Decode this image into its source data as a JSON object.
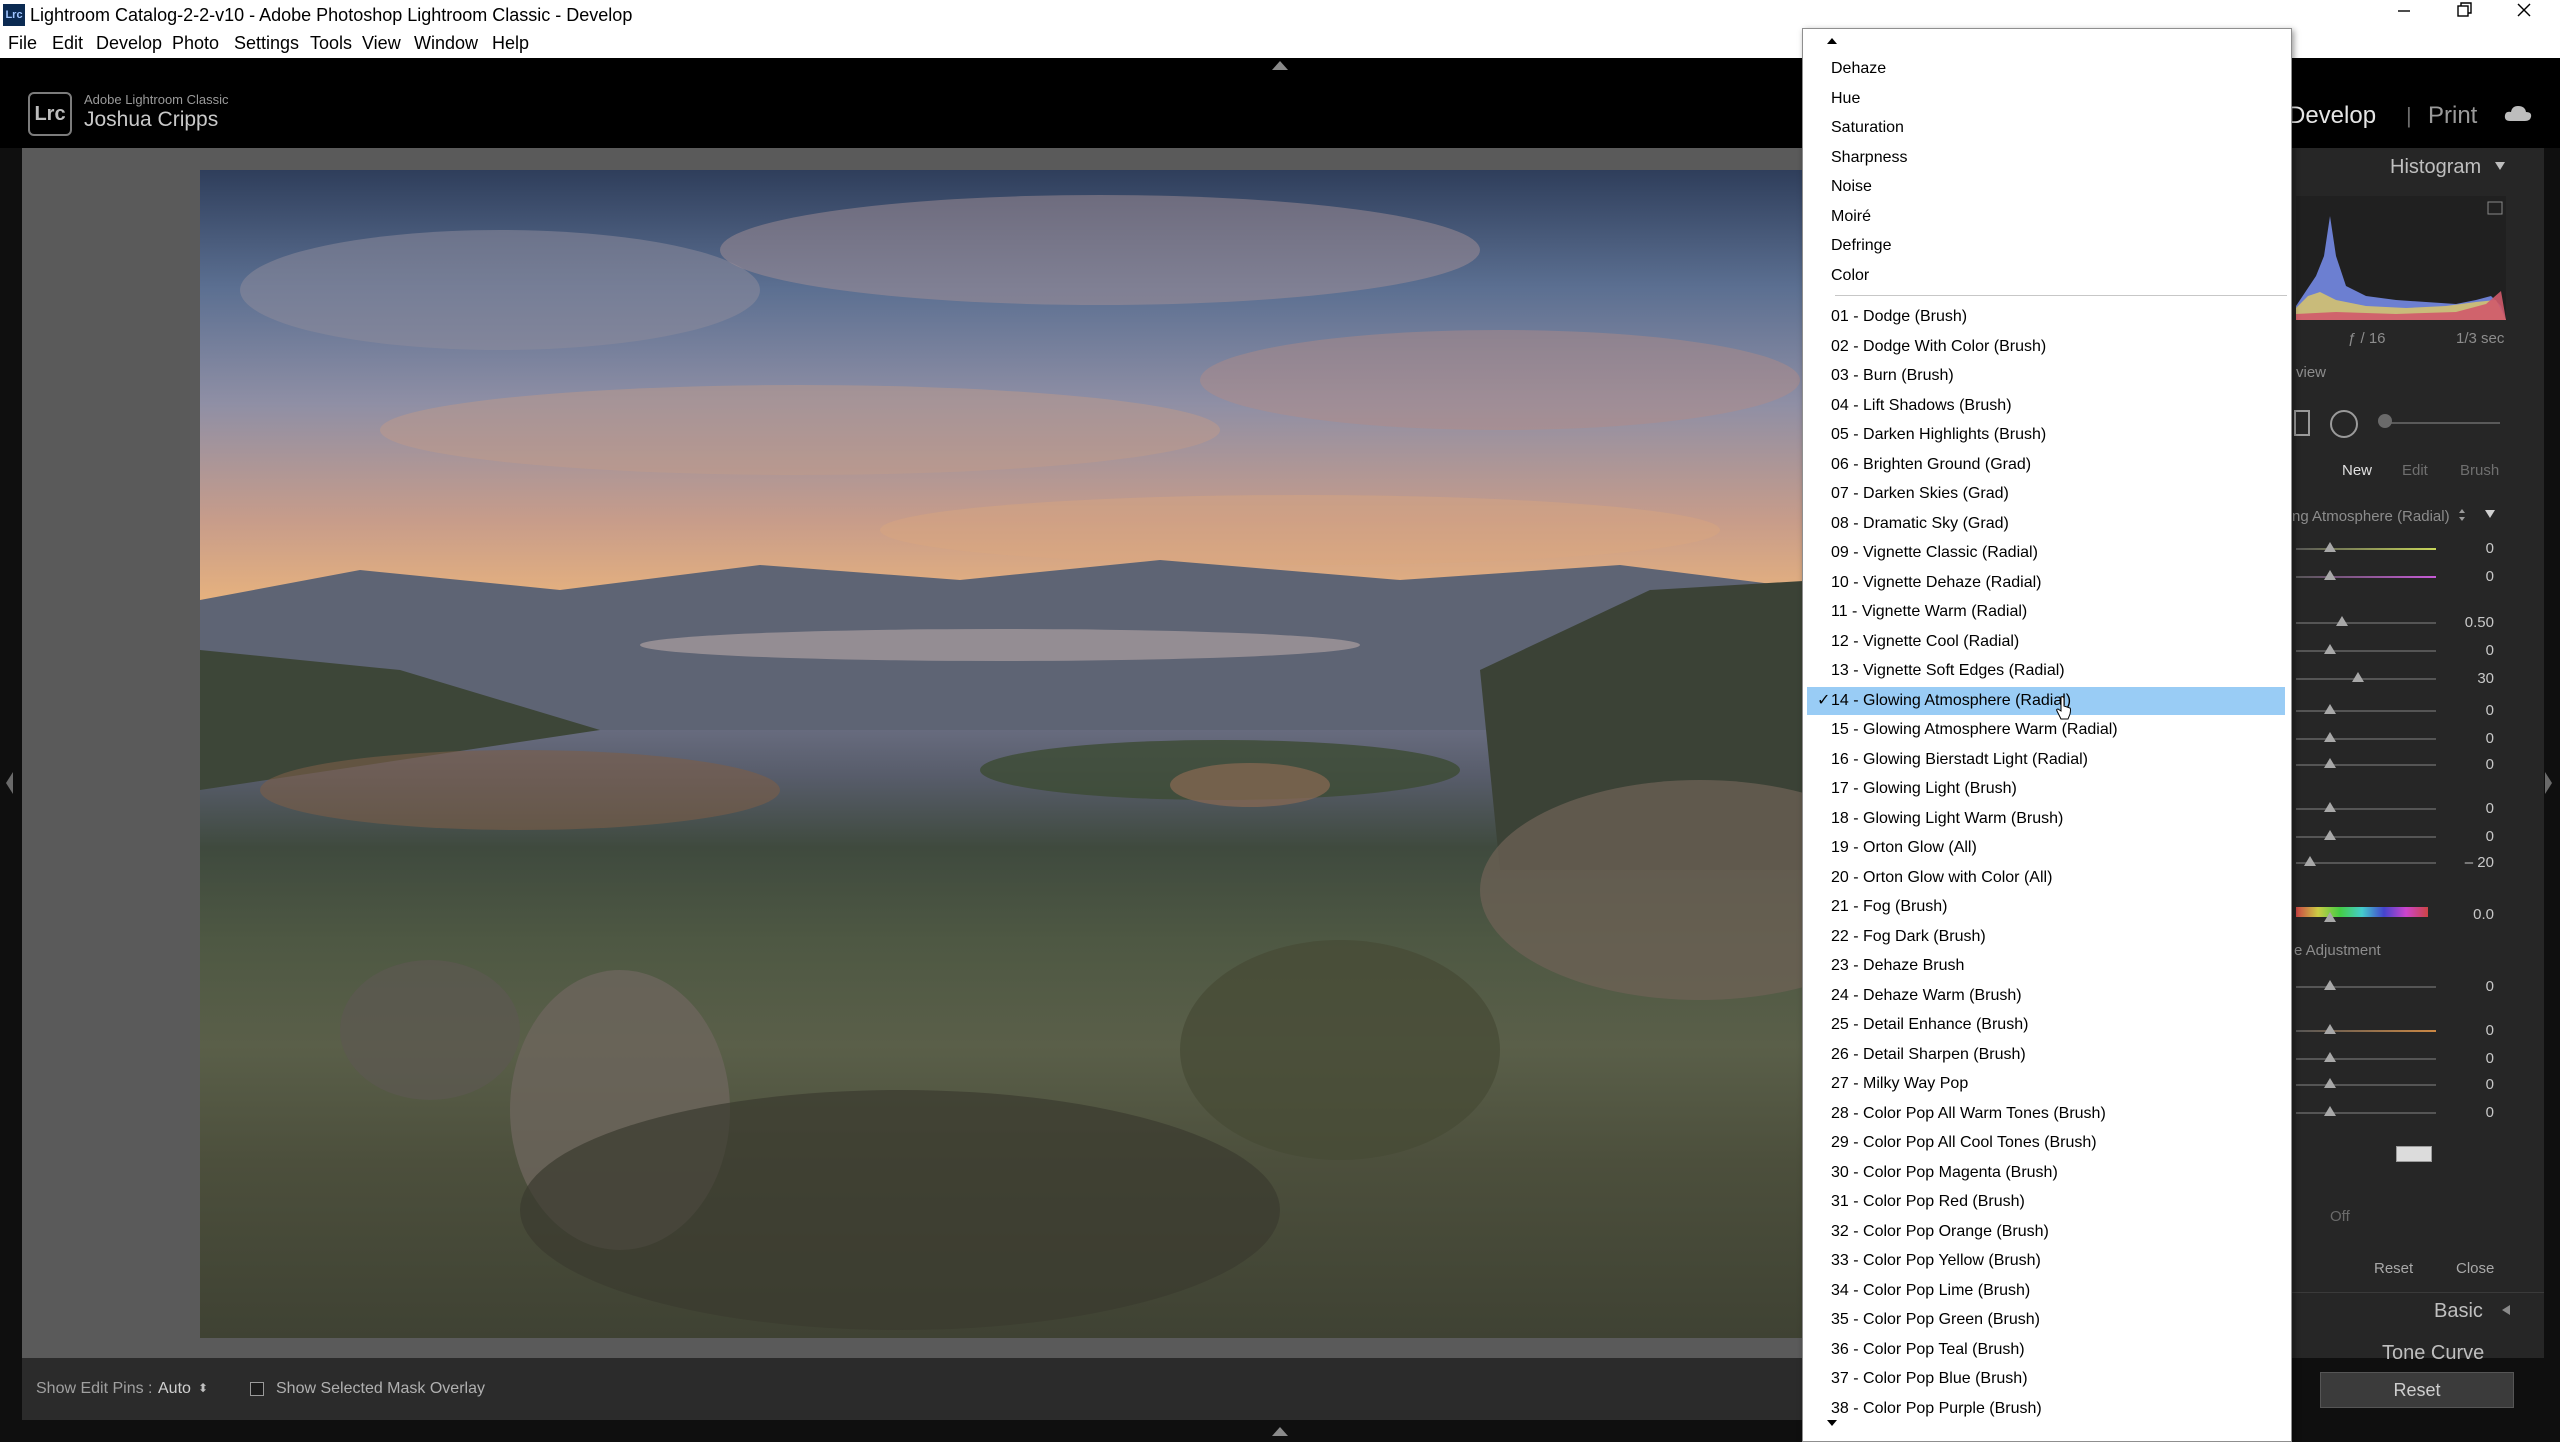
{
  "window": {
    "title": "Lightroom Catalog-2-2-v10 - Adobe Photoshop Lightroom Classic - Develop",
    "icon_label": "Lrc",
    "controls": [
      "minimize-icon",
      "restore-icon",
      "close-icon"
    ]
  },
  "menu": [
    "File",
    "Edit",
    "Develop",
    "Photo",
    "Settings",
    "Tools",
    "View",
    "Window",
    "Help"
  ],
  "header": {
    "logo": "Lrc",
    "product": "Adobe Lightroom Classic",
    "user": "Joshua Cripps",
    "modules": {
      "active": "Develop",
      "separator": "|",
      "next": "Print"
    }
  },
  "right_panel": {
    "histogram_title": "Histogram",
    "aperture": "ƒ / 16",
    "shutter": "1/3 sec",
    "preview_fragment": "view",
    "mask_tabs": {
      "new": "New",
      "edit": "Edit",
      "brush": "Brush"
    },
    "preset_fragment": "ng Atmosphere (Radial)",
    "sliders": [
      "0",
      "0",
      "0.50",
      "0",
      "30",
      "0",
      "0",
      "0",
      "0",
      "0",
      "– 20",
      "0.0",
      "0",
      "0",
      "0",
      "0",
      "0"
    ],
    "adjustment_fragment": "e Adjustment",
    "off_fragment": "Off",
    "reset_small": "Reset",
    "close_small": "Close",
    "basic": "Basic",
    "tone_curve": "Tone Curve",
    "reset_button": "Reset"
  },
  "toolbar": {
    "edit_pins_label": "Show Edit Pins :",
    "edit_pins_value": "Auto",
    "edit_pins_arrows": "⬍",
    "overlay_label": "Show Selected Mask Overlay"
  },
  "dropdown": {
    "effects": [
      "Dehaze",
      "Hue",
      "Saturation",
      "Sharpness",
      "Noise",
      "Moiré",
      "Defringe",
      "Color"
    ],
    "presets": [
      "01 - Dodge (Brush)",
      "02 - Dodge With Color (Brush)",
      "03 - Burn (Brush)",
      "04 - Lift Shadows (Brush)",
      "05 - Darken Highlights (Brush)",
      "06 - Brighten Ground (Grad)",
      "07 - Darken Skies (Grad)",
      "08 - Dramatic Sky (Grad)",
      "09 - Vignette Classic (Radial)",
      "10 - Vignette Dehaze (Radial)",
      "11 - Vignette Warm (Radial)",
      "12 - Vignette Cool (Radial)",
      "13 - Vignette Soft Edges (Radial)",
      "14 - Glowing Atmosphere (Radial)",
      "15 - Glowing Atmosphere Warm (Radial)",
      "16 - Glowing Bierstadt Light (Radial)",
      "17 - Glowing Light (Brush)",
      "18 - Glowing Light Warm (Brush)",
      "19 - Orton Glow (All)",
      "20 - Orton Glow with Color (All)",
      "21 - Fog (Brush)",
      "22 - Fog Dark (Brush)",
      "23 - Dehaze Brush",
      "24 - Dehaze Warm (Brush)",
      "25 - Detail Enhance (Brush)",
      "26 - Detail Sharpen (Brush)",
      "27 - Milky Way Pop",
      "28 - Color Pop All Warm Tones (Brush)",
      "29 - Color Pop All Cool Tones (Brush)",
      "30 - Color Pop Magenta (Brush)",
      "31 - Color Pop Red (Brush)",
      "32 - Color Pop Orange (Brush)",
      "33 - Color Pop Yellow (Brush)",
      "34 - Color Pop Lime (Brush)",
      "35 - Color Pop Green (Brush)",
      "36 - Color Pop Teal (Brush)",
      "37 - Color Pop Blue (Brush)",
      "38 - Color Pop Purple (Brush)"
    ],
    "selected_index": 13,
    "check_mark": "✓",
    "highlight_color": "#99ccf5"
  }
}
